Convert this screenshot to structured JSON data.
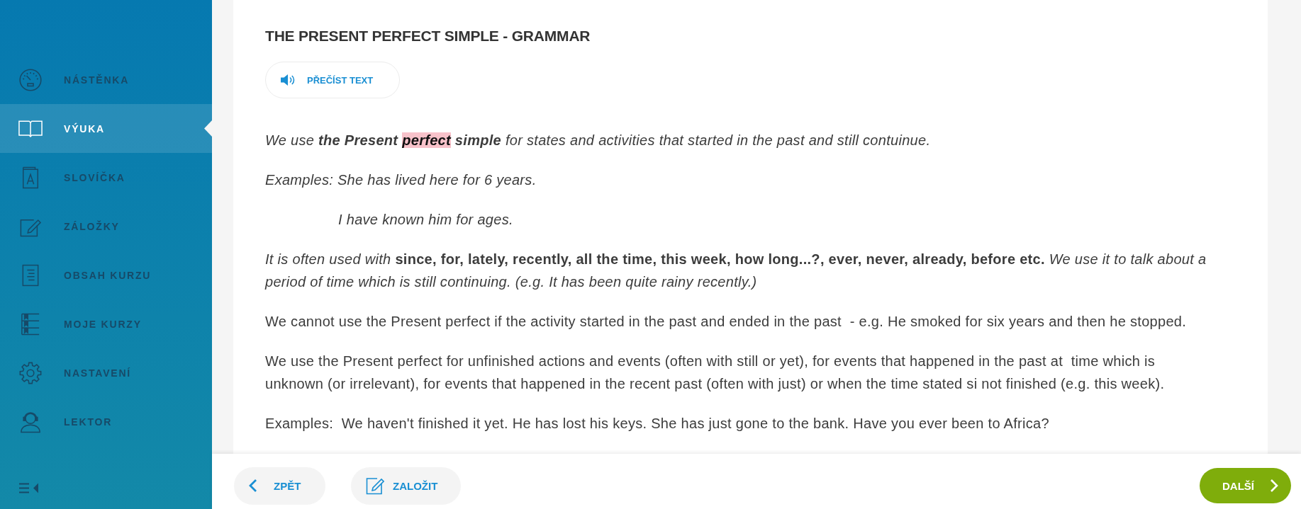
{
  "sidebar": {
    "items": [
      {
        "label": "NÁSTĚNKA",
        "selected": false
      },
      {
        "label": "VÝUKA",
        "selected": true
      },
      {
        "label": "SLOVÍČKA",
        "selected": false
      },
      {
        "label": "ZÁLOŽKY",
        "selected": false
      },
      {
        "label": "OBSAH KURZU",
        "selected": false
      },
      {
        "label": "MOJE KURZY",
        "selected": false
      },
      {
        "label": "NASTAVENÍ",
        "selected": false
      },
      {
        "label": "LEKTOR",
        "selected": false
      }
    ]
  },
  "lesson": {
    "title": "THE PRESENT PERFECT SIMPLE - GRAMMAR",
    "read_button": {
      "label": "PŘEČÍST TEXT"
    },
    "paragraphs": [
      {
        "kind": "italic",
        "segments": [
          {
            "text": "We use **the Present** ",
            "highlighted": false
          },
          {
            "text": "**perfect**",
            "highlighted": true
          },
          {
            "text": " **simple** for states and activities that started in the past and still contuinue.",
            "highlighted": false
          }
        ]
      },
      {
        "kind": "italic",
        "segments": [
          {
            "text": "Examples: She has lived here for 6 years.",
            "highlighted": false
          }
        ]
      },
      {
        "kind": "indented",
        "segments": [
          {
            "text": "I have known him for ages.",
            "highlighted": false
          }
        ]
      },
      {
        "kind": "plain",
        "segments": [
          {
            "text": "*It is often used with* **since, for, lately, recently, all the time, this week, how long...?, ever, never, already, before etc.** *We use it to talk about a period of time which is still continuing. (e.g. It has been quite rainy recently.)*",
            "highlighted": false
          }
        ]
      },
      {
        "kind": "plain",
        "segments": [
          {
            "text": "We cannot use the Present perfect if the activity started in the past and ended in the past  - e.g. He smoked for six years and then he stopped.",
            "highlighted": false
          }
        ]
      },
      {
        "kind": "plain",
        "segments": [
          {
            "text": "We use the Present perfect for unfinished actions and events (often with still or yet), for events that happened in the past at  time which is unknown (or irrelevant), for events that happened in the recent past (often with just) or when the time stated si not finished (e.g. this week).",
            "highlighted": false
          }
        ]
      },
      {
        "kind": "plain",
        "segments": [
          {
            "text": "Examples:  We haven't finished it yet. He has lost his keys. She has just gone to the bank. Have you ever been to Africa?",
            "highlighted": false
          }
        ]
      }
    ]
  },
  "bottom_bar": {
    "back_button": {
      "label": "ZPĚT"
    },
    "bookmark_button": {
      "label": "ZALOŽIT"
    },
    "next_button": {
      "label": "DALŠÍ"
    }
  }
}
